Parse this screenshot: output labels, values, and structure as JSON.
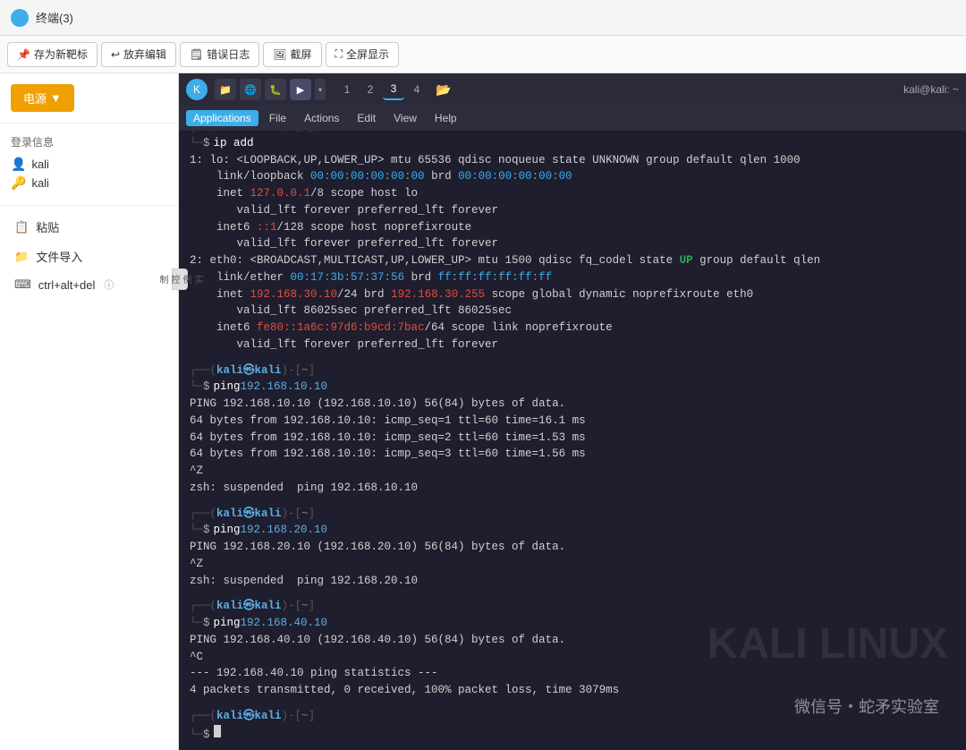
{
  "titlebar": {
    "title": "终端(3)"
  },
  "toolbar": {
    "buttons": [
      {
        "label": "存为新靶标",
        "icon": "📌"
      },
      {
        "label": "放弃编辑",
        "icon": "↩"
      },
      {
        "label": "错误日志",
        "icon": "🗒"
      },
      {
        "label": "截屏",
        "icon": "🖼"
      },
      {
        "label": "全屏显示",
        "icon": "⛶"
      }
    ]
  },
  "sidebar": {
    "power_label": "电源",
    "login_title": "登录信息",
    "login_user": "kali",
    "login_password": "kali",
    "actions": [
      {
        "label": "粘贴",
        "icon": "📋"
      },
      {
        "label": "文件导入",
        "icon": "📁"
      },
      {
        "label": "ctrl+alt+del",
        "icon": "⌨"
      }
    ],
    "instance_control": "实\n例\n控\n制"
  },
  "terminal": {
    "user": "kali@kali",
    "user_display": "kali@kali: ~",
    "menu": {
      "applications": "Applications",
      "file": "File",
      "actions": "Actions",
      "edit": "Edit",
      "view": "View",
      "help": "Help"
    },
    "tabs": [
      "1",
      "2",
      "3",
      "4"
    ],
    "content": [
      {
        "type": "prompt_cmd",
        "cmd": "ip add"
      },
      {
        "type": "output",
        "text": "1: lo: <LOOPBACK,UP,LOWER_UP> mtu 65536 qdisc noqueue state UNKNOWN group default qlen 1000"
      },
      {
        "type": "output_indent",
        "text": "link/loopback ",
        "mac1": "00:00:00:00:00:00",
        "mid": " brd ",
        "mac2": "00:00:00:00:00:00"
      },
      {
        "type": "output_indent2",
        "text": "inet ",
        "ip": "127.0.0.1",
        "rest": "/8 scope host lo"
      },
      {
        "type": "output_indent3",
        "text": "valid_lft forever preferred_lft forever"
      },
      {
        "type": "output_indent2",
        "text": "inet6 ",
        "ip": "::1",
        "rest": "/128 scope host noprefixroute"
      },
      {
        "type": "output_indent3",
        "text": "valid_lft forever preferred_lft forever"
      },
      {
        "type": "output",
        "text": "2: eth0: <BROADCAST,MULTICAST,UP,LOWER_UP> mtu 1500 qdisc fq_codel state UP group default qlen"
      },
      {
        "type": "output_indent",
        "text": "link/ether ",
        "mac1": "00:17:3b:57:37:56",
        "mid": " brd ",
        "mac2": "ff:ff:ff:ff:ff:ff"
      },
      {
        "type": "output_indent2",
        "text": "inet ",
        "ip": "192.168.30.10",
        "rest": "/24 brd ",
        "ip2": "192.168.30.255",
        "rest2": " scope global dynamic noprefixroute eth0"
      },
      {
        "type": "output_indent3",
        "text": "valid_lft 86025sec preferred_lft 86025sec"
      },
      {
        "type": "output_indent2",
        "text": "inet6 ",
        "ip": "fe80::1a6c:97d6:b9cd:7bac",
        "rest": "/64 scope link noprefixroute"
      },
      {
        "type": "output_indent3",
        "text": "valid_lft forever preferred_lft forever"
      },
      {
        "type": "gap"
      },
      {
        "type": "prompt_cmd",
        "cmd": "ping 192.168.10.10"
      },
      {
        "type": "output",
        "text": "PING 192.168.10.10 (192.168.10.10) 56(84) bytes of data."
      },
      {
        "type": "output",
        "text": "64 bytes from 192.168.10.10: icmp_seq=1 ttl=60 time=16.1 ms"
      },
      {
        "type": "output",
        "text": "64 bytes from 192.168.10.10: icmp_seq=2 ttl=60 time=1.53 ms"
      },
      {
        "type": "output",
        "text": "64 bytes from 192.168.10.10: icmp_seq=3 ttl=60 time=1.56 ms"
      },
      {
        "type": "output",
        "text": "^Z"
      },
      {
        "type": "output",
        "text": "zsh: suspended  ping 192.168.10.10"
      },
      {
        "type": "gap"
      },
      {
        "type": "prompt_cmd",
        "cmd": "ping 192.168.20.10"
      },
      {
        "type": "output",
        "text": "PING 192.168.20.10 (192.168.20.10) 56(84) bytes of data."
      },
      {
        "type": "output",
        "text": "^Z"
      },
      {
        "type": "output",
        "text": "zsh: suspended  ping 192.168.20.10"
      },
      {
        "type": "gap"
      },
      {
        "type": "prompt_cmd",
        "cmd": "ping 192.168.40.10"
      },
      {
        "type": "output",
        "text": "PING 192.168.40.10 (192.168.40.10) 56(84) bytes of data."
      },
      {
        "type": "output",
        "text": "^C"
      },
      {
        "type": "output",
        "text": "--- 192.168.40.10 ping statistics ---"
      },
      {
        "type": "output",
        "text": "4 packets transmitted, 0 received, 100% packet loss, time 3079ms"
      },
      {
        "type": "gap"
      },
      {
        "type": "prompt_cursor"
      }
    ]
  },
  "watermark": "KALI LINUX",
  "wechat": "微信号・蛇矛实验室"
}
